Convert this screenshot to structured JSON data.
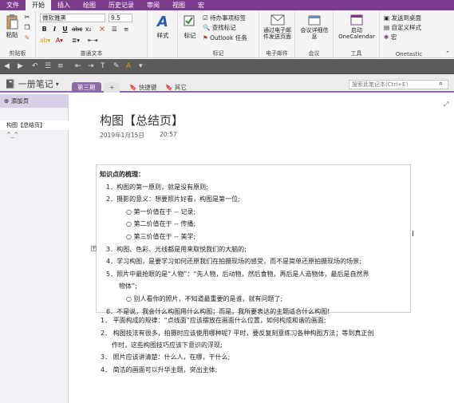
{
  "menubar": {
    "tabs": [
      "文件",
      "开始",
      "插入",
      "绘图",
      "历史记录",
      "审阅",
      "视图",
      "宏"
    ],
    "active_index": 1
  },
  "ribbon": {
    "clipboard": {
      "paste_label": "粘贴",
      "group_label": "剪贴板"
    },
    "text": {
      "font_name": "微软雅黑",
      "font_size": "9.5",
      "bold": "B",
      "italic": "I",
      "underline": "U",
      "group_label": "普通文本"
    },
    "styles": {
      "label": "样式"
    },
    "tags": {
      "tag_label": "标记",
      "todo_label": "待办事项标签",
      "find_tags_label": "查找标记",
      "outlook_label": "Outlook 任务",
      "group_label": "标记"
    },
    "email": {
      "button_label": "通过电子邮件发送页面",
      "group_label": "电子邮件"
    },
    "meetings": {
      "button_label": "会议详细信息",
      "group_label": "会议"
    },
    "onecalendar": {
      "button_label": "启动 OneCalendar",
      "group_label": "工具"
    },
    "onetastic": {
      "desktop_label": "发送到桌面",
      "custom_styles_label": "自定义样式",
      "macro_label": "宏",
      "group_label": "Onetastic"
    }
  },
  "notebook": {
    "title": "一册笔记",
    "sections": [
      "第三期",
      "+",
      "快捷键",
      "其它"
    ],
    "search_placeholder": "搜索此笔记本(Ctrl+E)"
  },
  "pages": {
    "add_page_label": "添加页",
    "items": [
      "构图【总结页】",
      "^_^"
    ]
  },
  "page": {
    "title": "构图【总结页】",
    "date": "2019年1月15日",
    "time": "20:57",
    "box_heading": "知识点的梳理：",
    "box_lines": [
      "1．构图的第一原则，就是没有原则;",
      "2．摄影的意义：想要照片好看，构图是第一位;",
      "第一价值在于 -- 记录;",
      "第二价值在于 -- 传播;",
      "第三价值在于 -- 美学;",
      "3．构图、色彩、光线都是用来取悦我们的大脑的;",
      "4．学习构图，是要学习如何还原我们在拍摄现场的感受，而不是简单还原拍摄现场的场景;",
      "5．照片中最抢眼的是“人物”：“先人物，后动物，然后食物，再后是人造物体，最后是自然界",
      "物体”;",
      "别人看你的照片，不知道最重要的是谁，就有问题了;",
      "6．不是说，我会什么构图用什么构图；而是，我所要表达的主题适合什么构图!"
    ],
    "after_lines": [
      "1．  平面构成的规律：“点线面”应该摆放在画面什么位置，如何构成和谐的画面;",
      "2．  构图技法有很多，拍摄时应该使用哪种呢? 平时，要反复刻意练习各种构图方法；等到真正创",
      "作时，这些构图技巧应该下意识的浮现;",
      "3．  照片应该讲清楚：什么人，在哪，干什么;",
      "4．  简洁的画面可以升华主题，突出主体;"
    ]
  },
  "colors": {
    "accent": "#7a3b8c",
    "pane": "#f3f0f6"
  }
}
